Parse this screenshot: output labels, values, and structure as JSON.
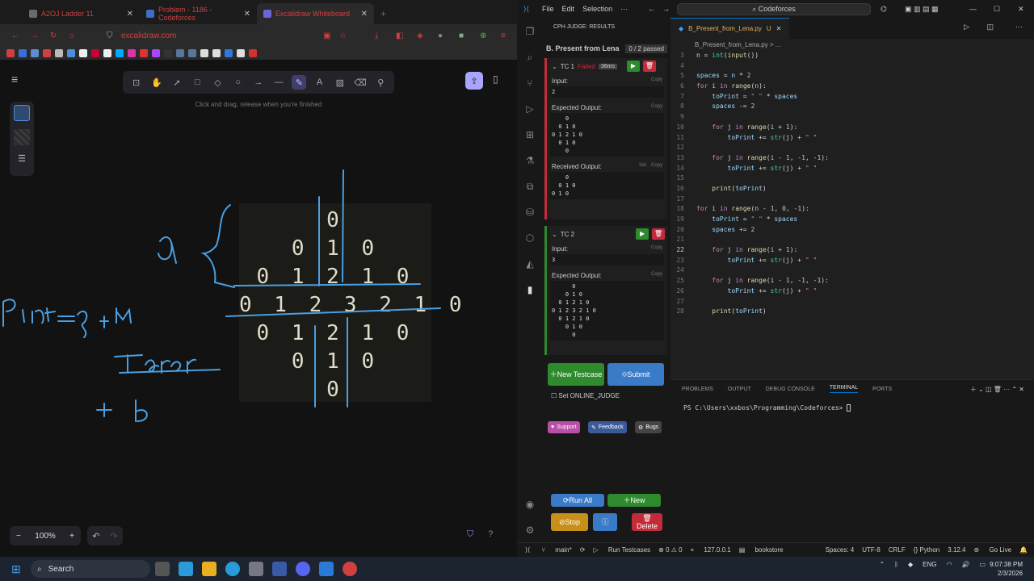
{
  "browser": {
    "tabs": [
      {
        "title": "A2OJ Ladder 11",
        "active": false
      },
      {
        "title": "Problem - 1186 - Codeforces",
        "active": false
      },
      {
        "title": "Excalidraw Whiteboard",
        "active": true
      }
    ],
    "url": "excalidraw.com"
  },
  "excalidraw": {
    "hint": "Click and drag, release when you're finished",
    "zoom": "100%",
    "diamond_rows": [
      "0",
      "0 1 0",
      "0 1 2 1 0",
      "0 1 2 3 2 1 0",
      "0 1 2 1 0",
      "0 1 0",
      "0"
    ]
  },
  "vscode": {
    "menu": [
      "File",
      "Edit",
      "Selection",
      "···"
    ],
    "command_center": "Codeforces",
    "cph": {
      "header": "CPH JUDGE: RESULTS",
      "problem": "B. Present from Lena",
      "passed": "0 / 2 passed",
      "tc1": {
        "label": "TC 1",
        "status": "Failed",
        "time": "36ms",
        "input_label": "Input:",
        "input": "2",
        "expected_label": "Expected Output:",
        "expected": "    0\n  0 1 0\n0 1 2 1 0\n  0 1 0\n    0",
        "received_label": "Received Output:",
        "received": "    0\n  0 1 0\n0 1 0",
        "set": "Set",
        "copy": "Copy"
      },
      "tc2": {
        "label": "TC 2",
        "input_label": "Input:",
        "input": "3",
        "expected_label": "Expected Output:",
        "expected": "      0\n    0 1 0\n  0 1 2 1 0\n0 1 2 3 2 1 0\n  0 1 2 1 0\n    0 1 0\n      0",
        "copy": "Copy"
      },
      "new_testcase": "New Testcase",
      "submit": "Submit",
      "online_judge": "Set ONLINE_JUDGE",
      "support": "Support",
      "feedback": "Feedback",
      "bugs": "Bugs",
      "run_all": "Run All",
      "new": "New",
      "stop": "Stop",
      "delete": "Delete"
    },
    "tab": {
      "name": "B_Present_from_Lena.py",
      "flag": "U"
    },
    "breadcrumb": "B_Present_from_Lena.py  >  ...",
    "code": [
      {
        "n": "3",
        "html": "<span class='vr'>n</span> = <span class='bi'>int</span>(<span class='fn'>input</span>())"
      },
      {
        "n": "4",
        "html": ""
      },
      {
        "n": "5",
        "html": "<span class='vr'>spaces</span> = <span class='vr'>n</span> * <span class='nm'>2</span>"
      },
      {
        "n": "6",
        "html": "<span class='kw'>for</span> <span class='vr'>i</span> <span class='kw'>in</span> <span class='fn'>range</span>(<span class='vr'>n</span>):"
      },
      {
        "n": "7",
        "html": "    <span class='vr'>toPrint</span> = <span class='st'>\" \"</span> * <span class='vr'>spaces</span>"
      },
      {
        "n": "8",
        "html": "    <span class='vr'>spaces</span> -= <span class='nm'>2</span>"
      },
      {
        "n": "9",
        "html": ""
      },
      {
        "n": "10",
        "html": "    <span class='kw'>for</span> <span class='vr'>j</span> <span class='kw'>in</span> <span class='fn'>range</span>(<span class='vr'>i</span> + <span class='nm'>1</span>):"
      },
      {
        "n": "11",
        "html": "        <span class='vr'>toPrint</span> += <span class='bi'>str</span>(<span class='vr'>j</span>) + <span class='st'>\" \"</span>"
      },
      {
        "n": "12",
        "html": ""
      },
      {
        "n": "13",
        "html": "    <span class='kw'>for</span> <span class='vr'>j</span> <span class='kw'>in</span> <span class='fn'>range</span>(<span class='vr'>i</span> - <span class='nm'>1</span>, -<span class='nm'>1</span>, -<span class='nm'>1</span>):"
      },
      {
        "n": "14",
        "html": "        <span class='vr'>toPrint</span> += <span class='bi'>str</span>(<span class='vr'>j</span>) + <span class='st'>\" \"</span>"
      },
      {
        "n": "15",
        "html": ""
      },
      {
        "n": "16",
        "html": "    <span class='fn'>print</span>(<span class='vr'>toPrint</span>)"
      },
      {
        "n": "17",
        "html": ""
      },
      {
        "n": "18",
        "html": "<span class='kw'>for</span> <span class='vr'>i</span> <span class='kw'>in</span> <span class='fn'>range</span>(<span class='vr'>n</span> - <span class='nm'>1</span>, <span class='nm'>0</span>, -<span class='nm'>1</span>):"
      },
      {
        "n": "19",
        "html": "    <span class='vr'>toPrint</span> = <span class='st'>\" \"</span> * <span class='vr'>spaces</span>"
      },
      {
        "n": "20",
        "html": "    <span class='vr'>spaces</span> += <span class='nm'>2</span>"
      },
      {
        "n": "21",
        "html": ""
      },
      {
        "n": "22",
        "html": "    <span class='kw'>for</span> <span class='vr'>j</span> <span class='kw'>in</span> <span class='fn'>range</span>(<span class='vr'>i</span> + <span class='nm'>1</span>):"
      },
      {
        "n": "23",
        "html": "        <span class='vr'>toPrint</span> += <span class='bi'>str</span>(<span class='vr'>j</span>) + <span class='st'>\" \"</span>"
      },
      {
        "n": "24",
        "html": ""
      },
      {
        "n": "25",
        "html": "    <span class='kw'>for</span> <span class='vr'>j</span> <span class='kw'>in</span> <span class='fn'>range</span>(<span class='vr'>i</span> - <span class='nm'>1</span>, -<span class='nm'>1</span>, -<span class='nm'>1</span>):"
      },
      {
        "n": "26",
        "html": "        <span class='vr'>toPrint</span> += <span class='bi'>str</span>(<span class='vr'>j</span>) + <span class='st'>\" \"</span>"
      },
      {
        "n": "27",
        "html": ""
      },
      {
        "n": "28",
        "html": "    <span class='fn'>print</span>(<span class='vr'>toPrint</span>)"
      }
    ],
    "current_line": "22",
    "panel_tabs": [
      "PROBLEMS",
      "OUTPUT",
      "DEBUG CONSOLE",
      "TERMINAL",
      "PORTS"
    ],
    "terminal": "PS C:\\Users\\xxbos\\Programming\\Codeforces> ",
    "status": {
      "branch": "main*",
      "run": "Run Testcases",
      "errors": "⊗ 0 ⚠ 0",
      "server": "127.0.0.1",
      "bookstore": "bookstore",
      "spaces": "Spaces: 4",
      "enc": "UTF-8",
      "eol": "CRLF",
      "lang": "{} Python",
      "ver": "3.12.4",
      "golive": "Go Live"
    }
  },
  "taskbar": {
    "search": "Search",
    "lang": "ENG",
    "time": "9:07:38 PM",
    "date": "2/3/2026"
  },
  "colors": {
    "accent": "#0078d4",
    "excalidraw_accent": "#a8a5ff",
    "fail": "#c42b3a",
    "pass": "#2d8a2d"
  }
}
